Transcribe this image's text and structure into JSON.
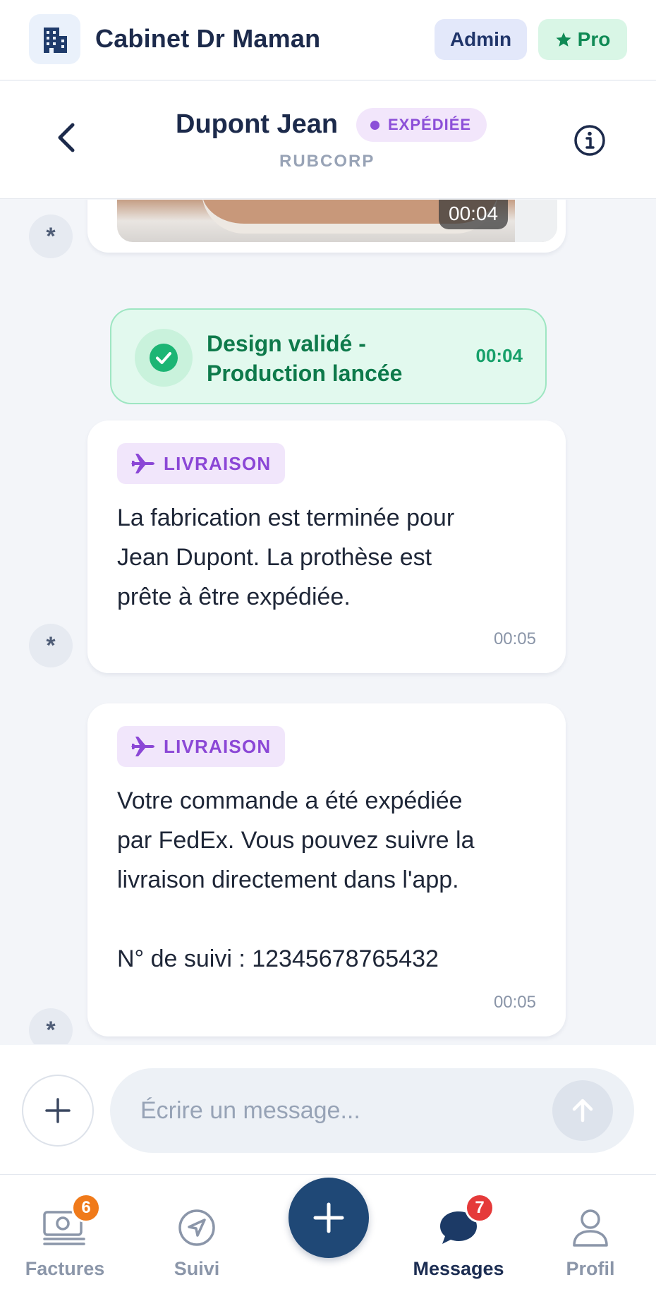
{
  "app_bar": {
    "title": "Cabinet Dr Maman",
    "role_badge": "Admin",
    "plan_badge": "Pro",
    "logo_icon": "building-icon"
  },
  "conversation": {
    "name": "Dupont Jean",
    "status": "EXPÉDIÉE",
    "company": "RUBCORP"
  },
  "messages": [
    {
      "type": "media",
      "time": "00:04",
      "author_avatar": "*"
    },
    {
      "type": "event",
      "text": "Design validé -\nProduction lancée",
      "time": "00:04"
    },
    {
      "type": "text",
      "tag": "LIVRAISON",
      "text": "La fabrication est terminée pour\nJean Dupont. La prothèse est\nprête à être expédiée.",
      "time": "00:05",
      "author_avatar": "*"
    },
    {
      "type": "text",
      "tag": "LIVRAISON",
      "text": "Votre commande a été expédiée\npar FedEx. Vous pouvez suivre la\nlivraison directement dans l'app.\n\nN° de suivi : 12345678765432",
      "time": "00:05",
      "author_avatar": "*"
    }
  ],
  "composer": {
    "placeholder": "Écrire un message..."
  },
  "bottom_nav": {
    "items": [
      {
        "label": "Factures",
        "icon": "money-icon",
        "badge": "6",
        "badge_color": "#f07a1a"
      },
      {
        "label": "Suivi",
        "icon": "navigation-icon"
      },
      {
        "label": "Messages",
        "icon": "chat-bubble-icon",
        "badge": "7",
        "badge_color": "#e53a3a",
        "active": true
      },
      {
        "label": "Profil",
        "icon": "user-icon"
      }
    ]
  },
  "colors": {
    "primary": "#1f4876",
    "status_purple": "#8c4fd8",
    "success_green": "#16a06a"
  }
}
